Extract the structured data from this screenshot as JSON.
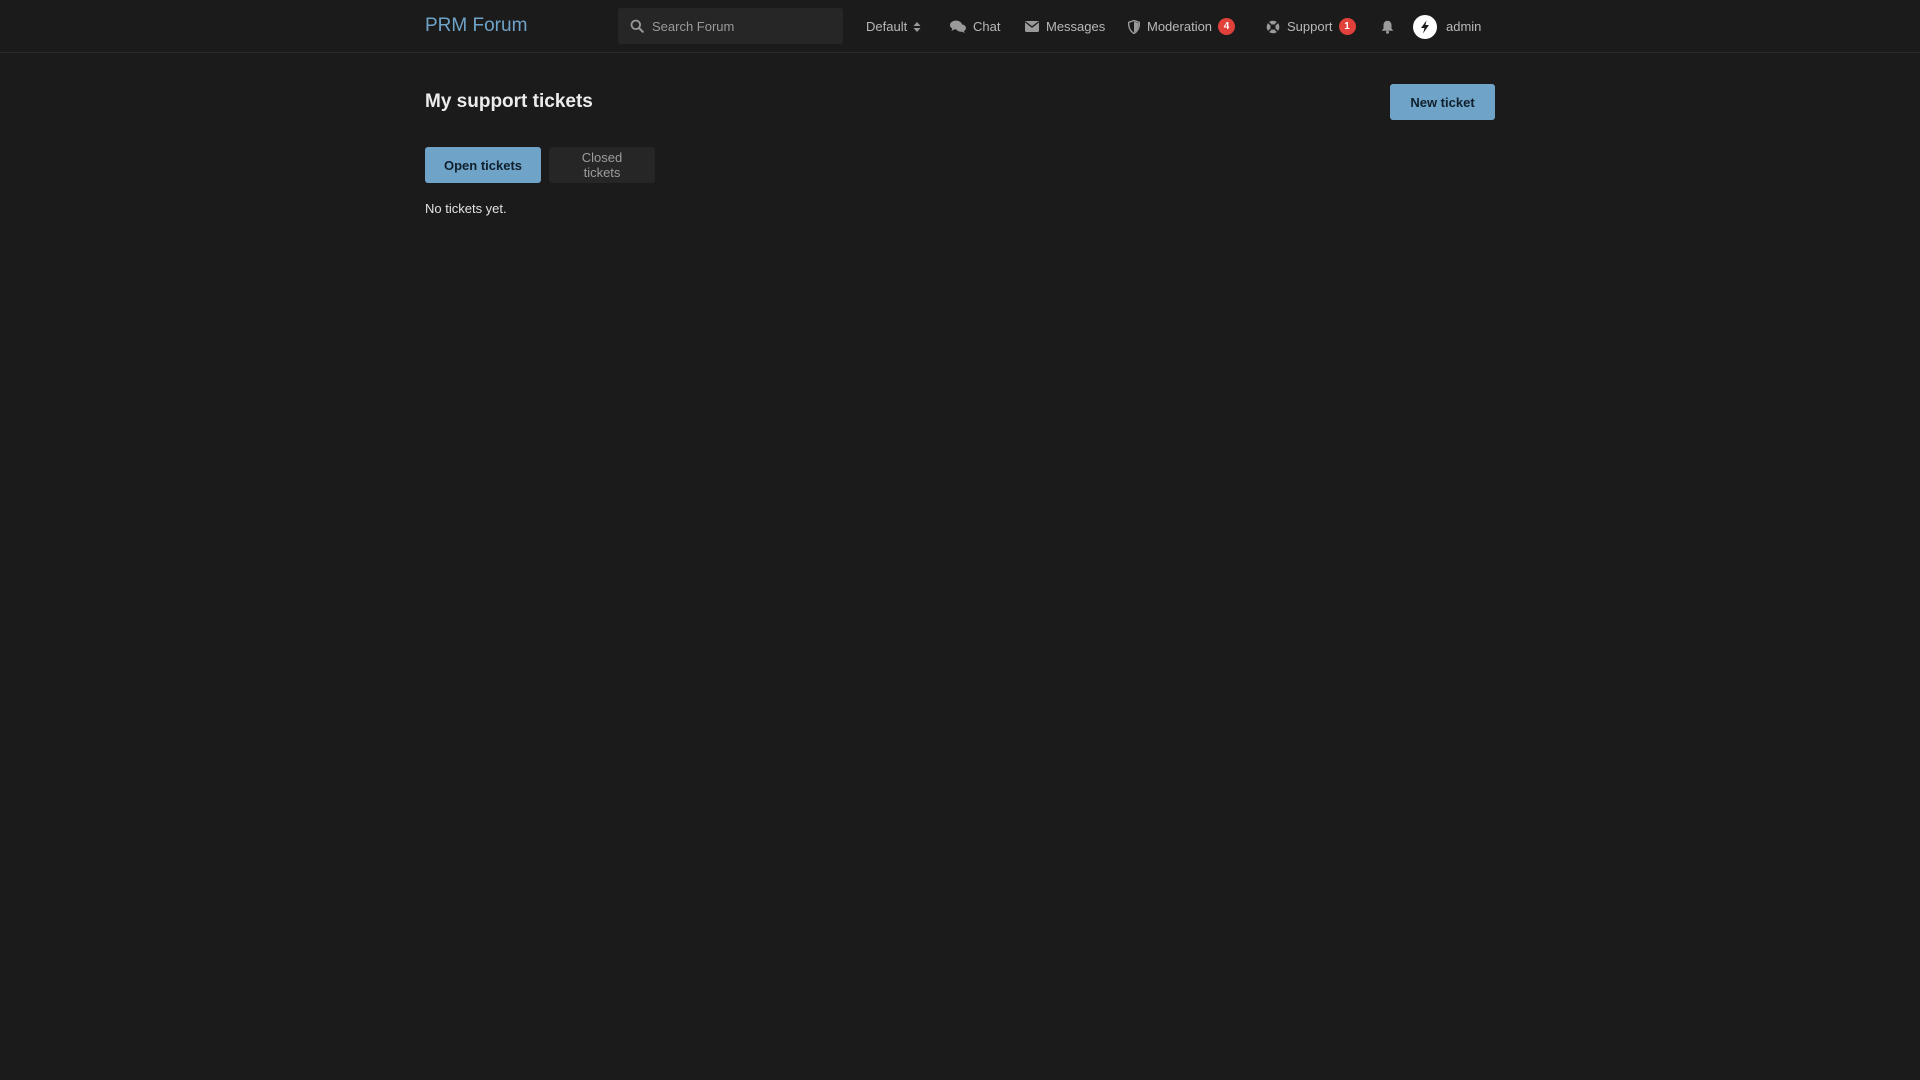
{
  "header": {
    "brand": "PRM Forum",
    "search": {
      "placeholder": "Search Forum"
    },
    "nav": {
      "theme": {
        "label": "Default"
      },
      "chat": {
        "label": "Chat"
      },
      "messages": {
        "label": "Messages"
      },
      "moderation": {
        "label": "Moderation",
        "badge": "4"
      },
      "support": {
        "label": "Support",
        "badge": "1"
      },
      "user": {
        "label": "admin"
      }
    }
  },
  "main": {
    "title": "My support tickets",
    "new_ticket_label": "New ticket",
    "tabs": [
      {
        "label": "Open tickets",
        "active": true
      },
      {
        "label": "Closed tickets",
        "active": false
      }
    ],
    "empty_message": "No tickets yet."
  },
  "colors": {
    "background": "#1b1b1b",
    "accent": "#6fa3c8",
    "badge": "#e0413a",
    "surface": "#262626"
  },
  "icons": {
    "search": "search-icon",
    "theme": "sort-caret-icon",
    "chat": "chat-bubbles-icon",
    "messages": "envelope-icon",
    "moderation": "shield-icon",
    "support": "lifebuoy-icon",
    "notifications": "bell-icon",
    "avatar": "flarum-logo-icon"
  }
}
